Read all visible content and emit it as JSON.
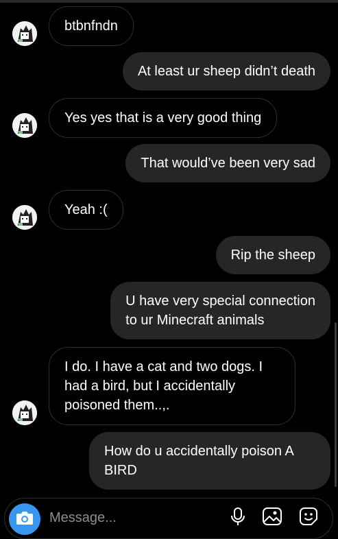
{
  "messages": [
    {
      "side": "received",
      "text": "btbnfndn"
    },
    {
      "side": "sent",
      "text": "At least ur sheep didn’t death"
    },
    {
      "side": "received",
      "text": "Yes yes that is a very good thing"
    },
    {
      "side": "sent",
      "text": "That would’ve been very sad"
    },
    {
      "side": "received",
      "text": "Yeah :("
    },
    {
      "side": "sent",
      "text": "Rip the sheep"
    },
    {
      "side": "sent",
      "text": "U have very special connection\nto ur Minecraft animals"
    },
    {
      "side": "received",
      "text": "I do. I have a cat and two dogs. I\nhad a bird, but I accidentally\npoisoned them..,."
    },
    {
      "side": "sent",
      "text": "How do u accidentally poison A\nBIRD"
    }
  ],
  "composer": {
    "placeholder": "Message..."
  },
  "colors": {
    "background": "#000000",
    "sent_bubble": "#262626",
    "received_border": "#2f2f2f",
    "accent": "#3797f0",
    "placeholder": "#8e8e8e"
  },
  "icons": {
    "camera": "camera-icon",
    "microphone": "microphone-icon",
    "gallery": "image-gallery-icon",
    "sticker": "sticker-icon"
  }
}
